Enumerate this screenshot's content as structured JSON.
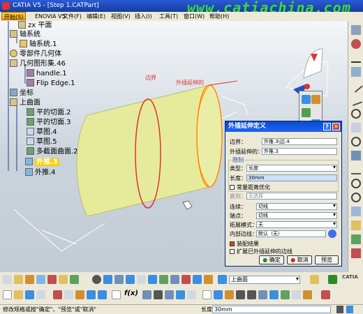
{
  "window": {
    "title": "CATIA V5 - [Step 1.CATPart]",
    "watermark": "www.catiachina.com"
  },
  "menu": {
    "start": "开始(S)",
    "items": [
      "ENOVIA V5",
      "文件(F)",
      "编辑(E)",
      "视图(V)",
      "插入(I)",
      "工具(T)",
      "窗口(W)",
      "帮助(H)"
    ]
  },
  "tree": {
    "items": [
      {
        "label": "zx 平面"
      },
      {
        "label": "轴系统"
      },
      {
        "label": "轴系统.1"
      },
      {
        "label": "零部件几何体"
      },
      {
        "label": "几何图形集.46"
      },
      {
        "label": "handle.1"
      },
      {
        "label": "Flip Edge.1"
      },
      {
        "label": "坐标"
      },
      {
        "label": "上曲面"
      },
      {
        "label": "平的切面.2"
      },
      {
        "label": "平的切面.3"
      },
      {
        "label": "草图.4"
      },
      {
        "label": "草图.5"
      },
      {
        "label": "多截面曲面.2"
      },
      {
        "label": "外推.3"
      },
      {
        "label": "外推.4"
      }
    ]
  },
  "viewport": {
    "annotation_outer": "外插延伸的",
    "annotation_other": "边界"
  },
  "dialog": {
    "title": "外插延伸定义",
    "boundary_label": "边界：",
    "boundary_value": "外推.3\\边.4",
    "extrapolated_label": "外插延伸的：",
    "extrapolated_value": "外推.3",
    "limit_section": "限制",
    "type_label": "类型：",
    "type_value": "长度",
    "length_label": "长度：",
    "length_value": "30mm",
    "opt_constant_distance": "常量距离优化",
    "until_label": "直到：",
    "until_value": "无选择",
    "continuity_label": "连续：",
    "continuity_value": "切线",
    "ends_label": "端点：",
    "ends_value": "切线",
    "propagation_label": "拓展模式：",
    "propagation_value": "无",
    "inner_edges_label": "内部边线：",
    "inner_edges_value": "默认（无）",
    "opt_assemble": "装配结果",
    "opt_extend_edges": "扩展已外插延伸的边线",
    "ok_label": "确定",
    "cancel_label": "取消",
    "preview_label": "预览"
  },
  "toolbar": {
    "surface_select": "上曲面"
  },
  "status": {
    "message": "修改规格或按\"确定\"、\"预览\"或\"取消\"",
    "length_label": "长度",
    "length_value": "30mm"
  },
  "colors": {
    "title_bg": "#1f4fc0",
    "selection": "#f6d000",
    "surface": "#e6eb9c",
    "edge_red": "#e03030"
  }
}
